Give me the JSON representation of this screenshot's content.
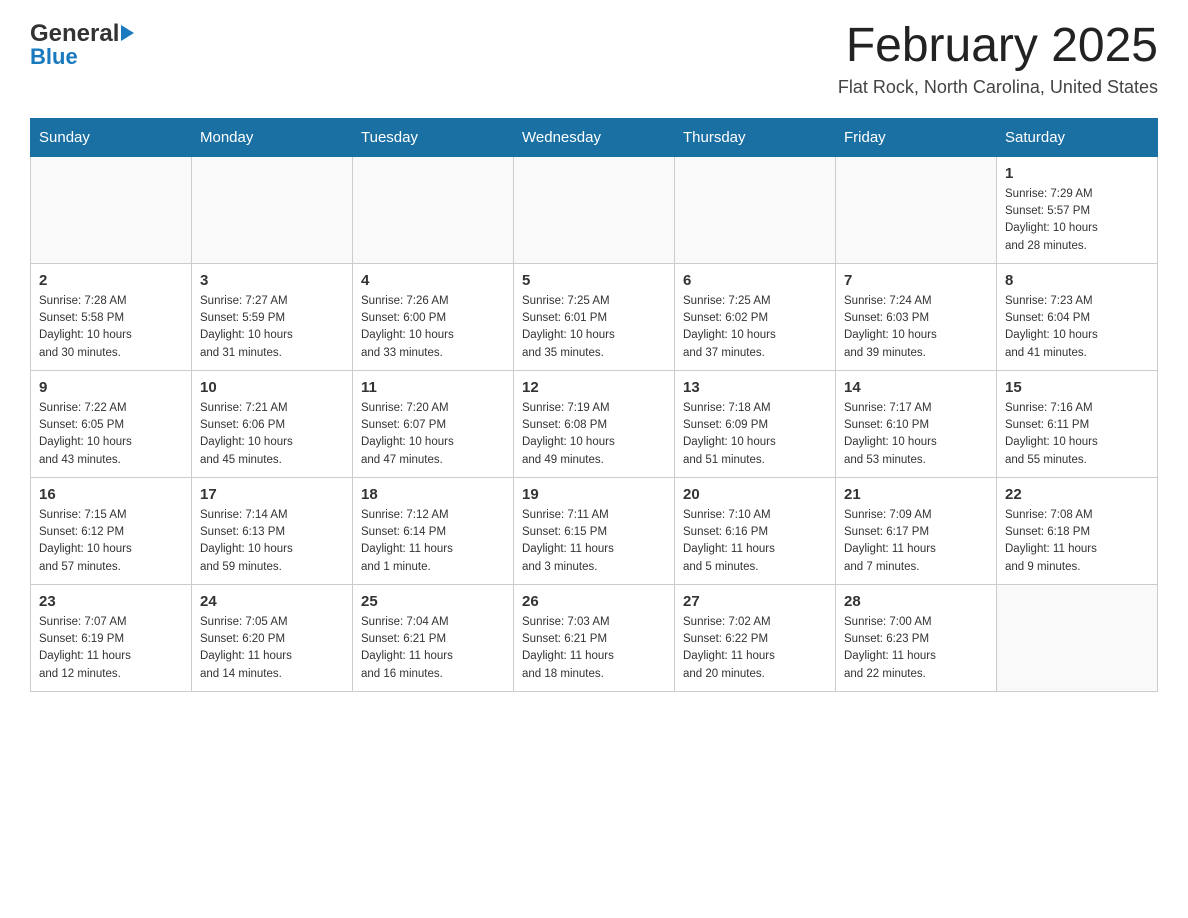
{
  "header": {
    "logo_general": "General",
    "logo_blue": "Blue",
    "month_title": "February 2025",
    "location": "Flat Rock, North Carolina, United States"
  },
  "days_of_week": [
    "Sunday",
    "Monday",
    "Tuesday",
    "Wednesday",
    "Thursday",
    "Friday",
    "Saturday"
  ],
  "weeks": [
    {
      "days": [
        {
          "number": "",
          "info": ""
        },
        {
          "number": "",
          "info": ""
        },
        {
          "number": "",
          "info": ""
        },
        {
          "number": "",
          "info": ""
        },
        {
          "number": "",
          "info": ""
        },
        {
          "number": "",
          "info": ""
        },
        {
          "number": "1",
          "info": "Sunrise: 7:29 AM\nSunset: 5:57 PM\nDaylight: 10 hours\nand 28 minutes."
        }
      ]
    },
    {
      "days": [
        {
          "number": "2",
          "info": "Sunrise: 7:28 AM\nSunset: 5:58 PM\nDaylight: 10 hours\nand 30 minutes."
        },
        {
          "number": "3",
          "info": "Sunrise: 7:27 AM\nSunset: 5:59 PM\nDaylight: 10 hours\nand 31 minutes."
        },
        {
          "number": "4",
          "info": "Sunrise: 7:26 AM\nSunset: 6:00 PM\nDaylight: 10 hours\nand 33 minutes."
        },
        {
          "number": "5",
          "info": "Sunrise: 7:25 AM\nSunset: 6:01 PM\nDaylight: 10 hours\nand 35 minutes."
        },
        {
          "number": "6",
          "info": "Sunrise: 7:25 AM\nSunset: 6:02 PM\nDaylight: 10 hours\nand 37 minutes."
        },
        {
          "number": "7",
          "info": "Sunrise: 7:24 AM\nSunset: 6:03 PM\nDaylight: 10 hours\nand 39 minutes."
        },
        {
          "number": "8",
          "info": "Sunrise: 7:23 AM\nSunset: 6:04 PM\nDaylight: 10 hours\nand 41 minutes."
        }
      ]
    },
    {
      "days": [
        {
          "number": "9",
          "info": "Sunrise: 7:22 AM\nSunset: 6:05 PM\nDaylight: 10 hours\nand 43 minutes."
        },
        {
          "number": "10",
          "info": "Sunrise: 7:21 AM\nSunset: 6:06 PM\nDaylight: 10 hours\nand 45 minutes."
        },
        {
          "number": "11",
          "info": "Sunrise: 7:20 AM\nSunset: 6:07 PM\nDaylight: 10 hours\nand 47 minutes."
        },
        {
          "number": "12",
          "info": "Sunrise: 7:19 AM\nSunset: 6:08 PM\nDaylight: 10 hours\nand 49 minutes."
        },
        {
          "number": "13",
          "info": "Sunrise: 7:18 AM\nSunset: 6:09 PM\nDaylight: 10 hours\nand 51 minutes."
        },
        {
          "number": "14",
          "info": "Sunrise: 7:17 AM\nSunset: 6:10 PM\nDaylight: 10 hours\nand 53 minutes."
        },
        {
          "number": "15",
          "info": "Sunrise: 7:16 AM\nSunset: 6:11 PM\nDaylight: 10 hours\nand 55 minutes."
        }
      ]
    },
    {
      "days": [
        {
          "number": "16",
          "info": "Sunrise: 7:15 AM\nSunset: 6:12 PM\nDaylight: 10 hours\nand 57 minutes."
        },
        {
          "number": "17",
          "info": "Sunrise: 7:14 AM\nSunset: 6:13 PM\nDaylight: 10 hours\nand 59 minutes."
        },
        {
          "number": "18",
          "info": "Sunrise: 7:12 AM\nSunset: 6:14 PM\nDaylight: 11 hours\nand 1 minute."
        },
        {
          "number": "19",
          "info": "Sunrise: 7:11 AM\nSunset: 6:15 PM\nDaylight: 11 hours\nand 3 minutes."
        },
        {
          "number": "20",
          "info": "Sunrise: 7:10 AM\nSunset: 6:16 PM\nDaylight: 11 hours\nand 5 minutes."
        },
        {
          "number": "21",
          "info": "Sunrise: 7:09 AM\nSunset: 6:17 PM\nDaylight: 11 hours\nand 7 minutes."
        },
        {
          "number": "22",
          "info": "Sunrise: 7:08 AM\nSunset: 6:18 PM\nDaylight: 11 hours\nand 9 minutes."
        }
      ]
    },
    {
      "days": [
        {
          "number": "23",
          "info": "Sunrise: 7:07 AM\nSunset: 6:19 PM\nDaylight: 11 hours\nand 12 minutes."
        },
        {
          "number": "24",
          "info": "Sunrise: 7:05 AM\nSunset: 6:20 PM\nDaylight: 11 hours\nand 14 minutes."
        },
        {
          "number": "25",
          "info": "Sunrise: 7:04 AM\nSunset: 6:21 PM\nDaylight: 11 hours\nand 16 minutes."
        },
        {
          "number": "26",
          "info": "Sunrise: 7:03 AM\nSunset: 6:21 PM\nDaylight: 11 hours\nand 18 minutes."
        },
        {
          "number": "27",
          "info": "Sunrise: 7:02 AM\nSunset: 6:22 PM\nDaylight: 11 hours\nand 20 minutes."
        },
        {
          "number": "28",
          "info": "Sunrise: 7:00 AM\nSunset: 6:23 PM\nDaylight: 11 hours\nand 22 minutes."
        },
        {
          "number": "",
          "info": ""
        }
      ]
    }
  ]
}
